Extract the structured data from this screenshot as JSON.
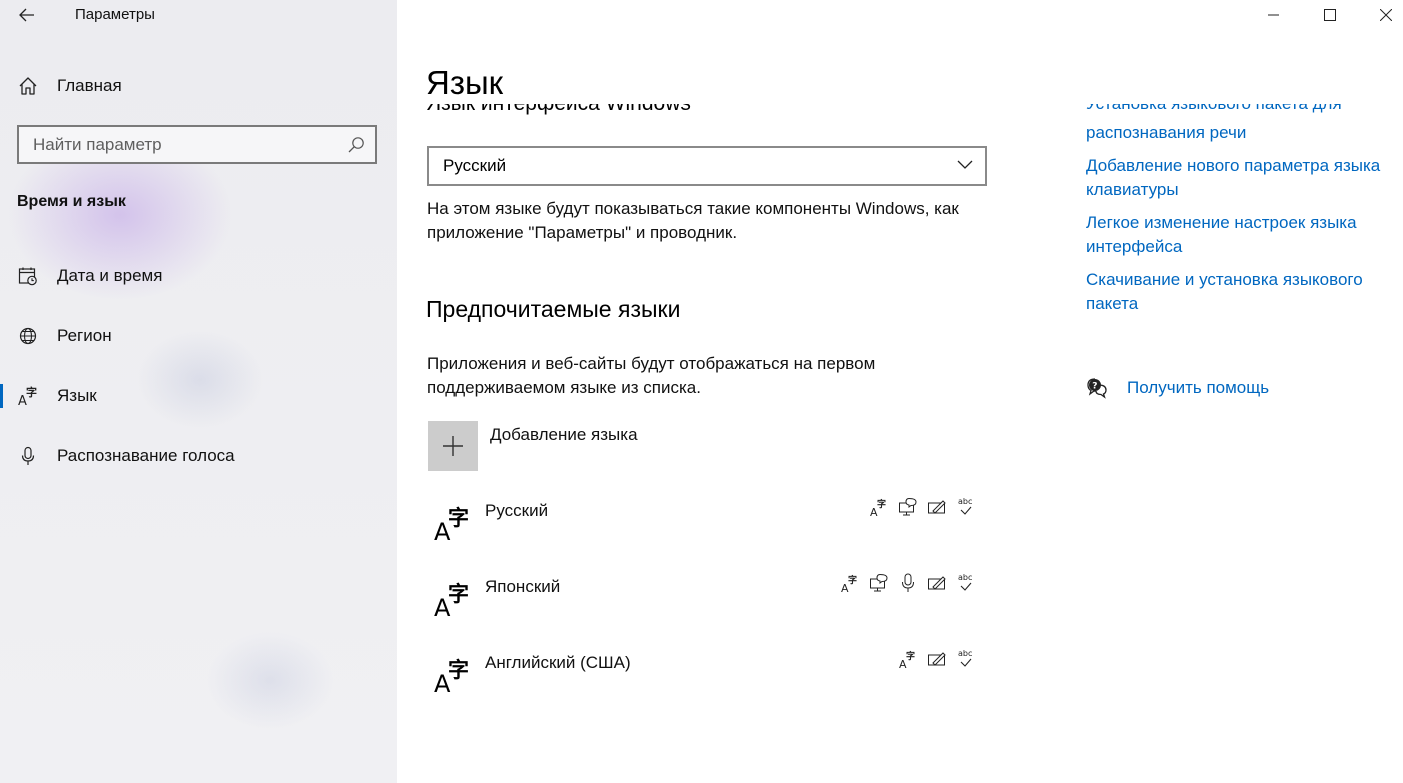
{
  "window": {
    "title": "Параметры",
    "controls": [
      "minimize-icon",
      "maximize-icon",
      "close-icon"
    ]
  },
  "sidebar": {
    "home_label": "Главная",
    "search_placeholder": "Найти параметр",
    "section_title": "Время и язык",
    "items": [
      {
        "label": "Дата и время",
        "icon": "calendar-clock-icon",
        "selected": false
      },
      {
        "label": "Регион",
        "icon": "globe-icon",
        "selected": false
      },
      {
        "label": "Язык",
        "icon": "language-icon",
        "selected": true
      },
      {
        "label": "Распознавание голоса",
        "icon": "microphone-icon",
        "selected": false
      }
    ]
  },
  "main": {
    "title": "Язык",
    "clipped_heading": "Язык интерфейса Windows",
    "display_language": {
      "value": "Русский",
      "description": "На этом языке будут показываться такие компоненты Windows, как приложение \"Параметры\" и проводник."
    },
    "preferred": {
      "heading": "Предпочитаемые языки",
      "description": "Приложения и веб-сайты будут отображаться на первом поддерживаемом языке из списка.",
      "add_label": "Добавление языка",
      "languages": [
        {
          "name": "Русский",
          "features": [
            "display-language-icon",
            "text-to-speech-icon",
            "handwriting-icon",
            "spellcheck-icon"
          ]
        },
        {
          "name": "Японский",
          "features": [
            "display-language-icon",
            "text-to-speech-icon",
            "speech-recognition-icon",
            "handwriting-icon",
            "spellcheck-icon"
          ]
        },
        {
          "name": "Английский (США)",
          "features": [
            "display-language-icon",
            "handwriting-icon",
            "spellcheck-icon"
          ]
        }
      ]
    }
  },
  "related": {
    "clipped_link": "Установка языкового пакета для",
    "links": [
      {
        "text": "распознавания речи"
      },
      {
        "text": "Добавление нового параметра языка клавиатуры"
      },
      {
        "text": "Легкое изменение настроек языка интерфейса"
      },
      {
        "text": "Скачивание и установка языкового пакета"
      }
    ],
    "help_label": "Получить помощь"
  },
  "colors": {
    "accent": "#0067c0",
    "sidebar_bg": "#eeeef2",
    "add_tile": "#cccccc"
  }
}
